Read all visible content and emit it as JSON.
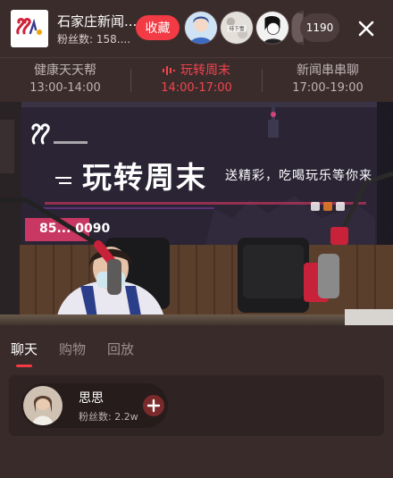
{
  "header": {
    "station_name": "石家庄新闻...",
    "fans_label": "粉丝数: 158....",
    "favorite_label": "收藏",
    "viewer_count": "1190",
    "avatar_3_text": "待下雪"
  },
  "programs": [
    {
      "name": "健康天天帮",
      "time": "13:00-14:00",
      "active": false
    },
    {
      "name": "玩转周末",
      "time": "14:00-17:00",
      "active": true
    },
    {
      "name": "新闻串串聊",
      "time": "17:00-19:00",
      "active": false
    }
  ],
  "video": {
    "banner_title": "玩转周末",
    "banner_subtitle": "送精彩，吃喝玩乐等你来",
    "banner_phone": "85... 0090"
  },
  "chat_tabs": [
    "聊天",
    "购物",
    "回放"
  ],
  "chat": {
    "user_name": "思思",
    "user_fans": "粉丝数: 2.2w"
  },
  "colors": {
    "accent": "#f23b44",
    "background": "#3a2b2b"
  }
}
